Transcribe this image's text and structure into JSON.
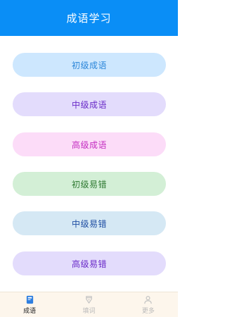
{
  "header": {
    "title": "成语学习"
  },
  "buttons": [
    {
      "label": "初级成语",
      "bg": "#cde7fe",
      "fg": "#2b86d9"
    },
    {
      "label": "中级成语",
      "bg": "#e3dcfc",
      "fg": "#6a2bc8"
    },
    {
      "label": "高级成语",
      "bg": "#fcdcf8",
      "fg": "#c42ec1"
    },
    {
      "label": "初级易错",
      "bg": "#d3efd6",
      "fg": "#2f7a32"
    },
    {
      "label": "中级易错",
      "bg": "#d5e8f4",
      "fg": "#1f4ea3"
    },
    {
      "label": "高级易错",
      "bg": "#e3dcfc",
      "fg": "#6a2bc8"
    }
  ],
  "tabbar": {
    "tabs": [
      {
        "label": "成语",
        "icon": "book-icon",
        "active": true
      },
      {
        "label": "填词",
        "icon": "pen-nib-icon",
        "active": false
      },
      {
        "label": "更多",
        "icon": "person-icon",
        "active": false
      }
    ]
  },
  "colors": {
    "header_bg": "#0a8ef6",
    "active_icon": "#2f7fe0",
    "inactive_icon": "#c4c4c4",
    "tabbar_bg": "#fdf6ec"
  }
}
